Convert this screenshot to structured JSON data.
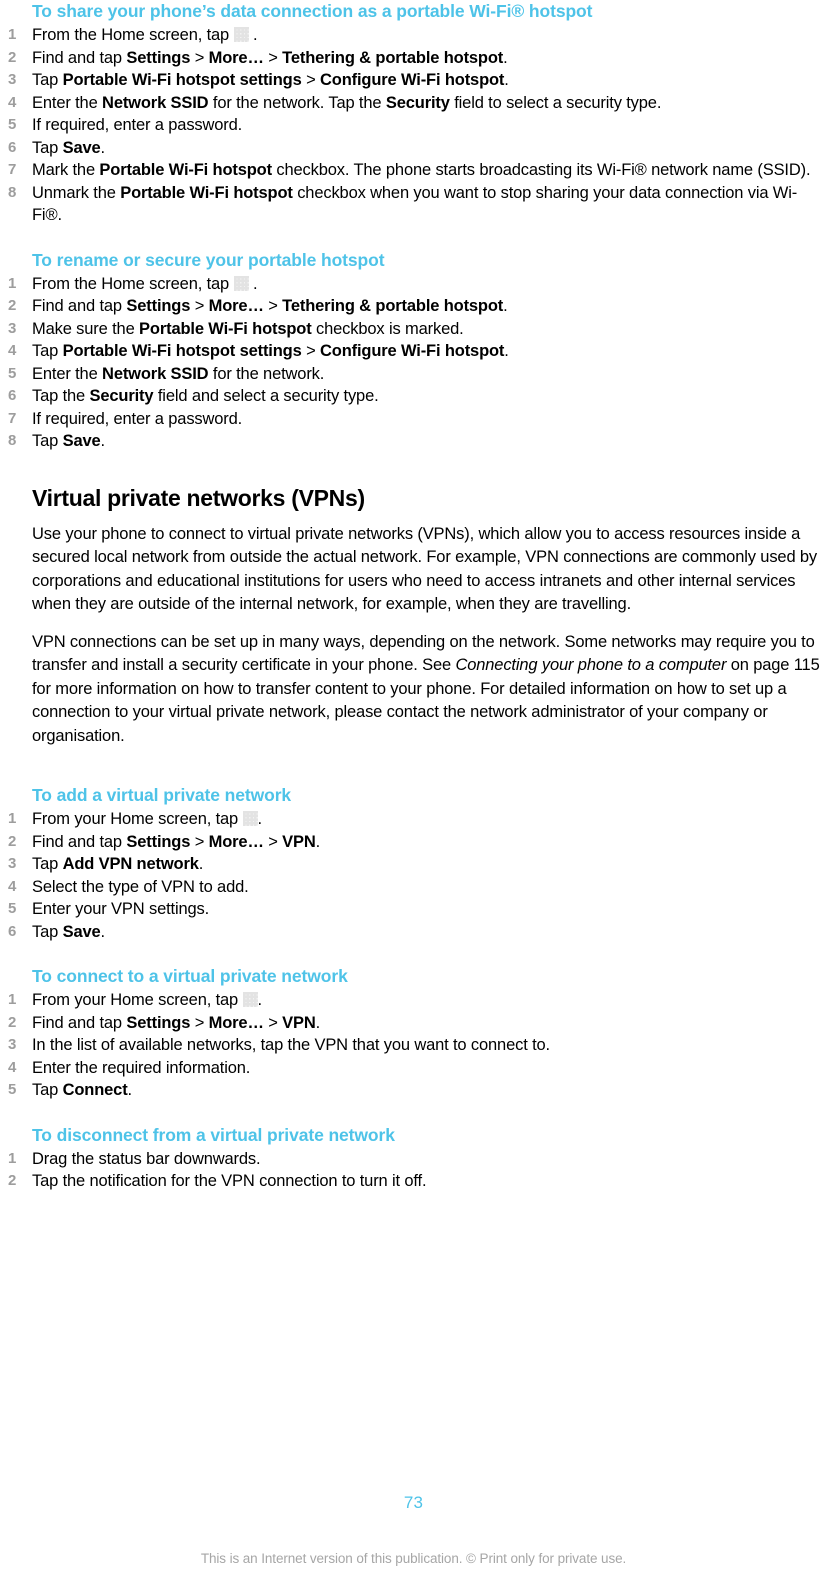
{
  "document": {
    "page_number": "73",
    "footer_note": "This is an Internet version of this publication. © Print only for private use.",
    "accent_color": "#4ec3e8",
    "step_number_color": "#9d9d9d",
    "icon_name": "app-drawer-grid-icon"
  },
  "sections": [
    {
      "id": "share-hotspot",
      "type": "task",
      "heading": "To share your phone’s data connection as a portable Wi-Fi® hotspot",
      "steps": [
        {
          "pre": "From the Home screen, tap ",
          "icon": true,
          "post": " ."
        },
        {
          "parts": [
            {
              "t": "Find and tap ",
              "b": false
            },
            {
              "t": "Settings",
              "b": true
            },
            {
              "t": " > ",
              "b": false
            },
            {
              "t": "More…",
              "b": true
            },
            {
              "t": " > ",
              "b": false
            },
            {
              "t": "Tethering & portable hotspot",
              "b": true
            },
            {
              "t": ".",
              "b": false
            }
          ]
        },
        {
          "parts": [
            {
              "t": "Tap ",
              "b": false
            },
            {
              "t": "Portable Wi-Fi hotspot settings",
              "b": true
            },
            {
              "t": " > ",
              "b": false
            },
            {
              "t": "Configure Wi-Fi hotspot",
              "b": true
            },
            {
              "t": ".",
              "b": false
            }
          ]
        },
        {
          "parts": [
            {
              "t": "Enter the ",
              "b": false
            },
            {
              "t": "Network SSID",
              "b": true
            },
            {
              "t": " for the network. Tap the ",
              "b": false
            },
            {
              "t": "Security",
              "b": true
            },
            {
              "t": " field to select a security type.",
              "b": false
            }
          ]
        },
        {
          "parts": [
            {
              "t": "If required, enter a password.",
              "b": false
            }
          ]
        },
        {
          "parts": [
            {
              "t": "Tap ",
              "b": false
            },
            {
              "t": "Save",
              "b": true
            },
            {
              "t": ".",
              "b": false
            }
          ]
        },
        {
          "parts": [
            {
              "t": "Mark the ",
              "b": false
            },
            {
              "t": "Portable Wi-Fi hotspot",
              "b": true
            },
            {
              "t": " checkbox. The phone starts broadcasting its Wi-Fi® network name (SSID).",
              "b": false
            }
          ]
        },
        {
          "parts": [
            {
              "t": "Unmark the ",
              "b": false
            },
            {
              "t": "Portable Wi-Fi hotspot",
              "b": true
            },
            {
              "t": " checkbox when you want to stop sharing your data connection via Wi-Fi®.",
              "b": false
            }
          ]
        }
      ]
    },
    {
      "id": "rename-secure-hotspot",
      "type": "task",
      "heading": "To rename or secure your portable hotspot",
      "steps": [
        {
          "pre": "From the Home screen, tap ",
          "icon": true,
          "post": " ."
        },
        {
          "parts": [
            {
              "t": "Find and tap ",
              "b": false
            },
            {
              "t": "Settings",
              "b": true
            },
            {
              "t": " > ",
              "b": false
            },
            {
              "t": "More…",
              "b": true
            },
            {
              "t": " > ",
              "b": false
            },
            {
              "t": "Tethering & portable hotspot",
              "b": true
            },
            {
              "t": ".",
              "b": false
            }
          ]
        },
        {
          "parts": [
            {
              "t": "Make sure the ",
              "b": false
            },
            {
              "t": "Portable Wi-Fi hotspot",
              "b": true
            },
            {
              "t": " checkbox is marked.",
              "b": false
            }
          ]
        },
        {
          "parts": [
            {
              "t": "Tap ",
              "b": false
            },
            {
              "t": "Portable Wi-Fi hotspot settings",
              "b": true
            },
            {
              "t": " > ",
              "b": false
            },
            {
              "t": "Configure Wi-Fi hotspot",
              "b": true
            },
            {
              "t": ".",
              "b": false
            }
          ]
        },
        {
          "parts": [
            {
              "t": "Enter the ",
              "b": false
            },
            {
              "t": "Network SSID",
              "b": true
            },
            {
              "t": " for the network.",
              "b": false
            }
          ]
        },
        {
          "parts": [
            {
              "t": "Tap the ",
              "b": false
            },
            {
              "t": "Security",
              "b": true
            },
            {
              "t": " field and select a security type.",
              "b": false
            }
          ]
        },
        {
          "parts": [
            {
              "t": "If required, enter a password.",
              "b": false
            }
          ]
        },
        {
          "parts": [
            {
              "t": "Tap ",
              "b": false
            },
            {
              "t": "Save",
              "b": true
            },
            {
              "t": ".",
              "b": false
            }
          ]
        }
      ]
    },
    {
      "id": "vpn",
      "type": "section",
      "heading": "Virtual private networks (VPNs)",
      "paragraphs": [
        [
          {
            "t": "Use your phone to connect to virtual private networks (VPNs), which allow you to access resources inside a secured local network from outside the actual network. For example, VPN connections are commonly used by corporations and educational institutions for users who need to access intranets and other internal services when they are outside of the internal network, for example, when they are travelling.",
            "i": false
          }
        ],
        [
          {
            "t": "VPN connections can be set up in many ways, depending on the network. Some networks may require you to transfer and install a security certificate in your phone. See ",
            "i": false
          },
          {
            "t": "Connecting your phone to a computer",
            "i": true
          },
          {
            "t": " on page 115 for more information on how to transfer content to your phone. For detailed information on how to set up a connection to your virtual private network, please contact the network administrator of your company or organisation.",
            "i": false
          }
        ]
      ]
    },
    {
      "id": "add-vpn",
      "type": "task",
      "heading": "To add a virtual private network",
      "steps": [
        {
          "pre": "From your Home screen, tap ",
          "icon": true,
          "post": "."
        },
        {
          "parts": [
            {
              "t": "Find and tap ",
              "b": false
            },
            {
              "t": "Settings",
              "b": true
            },
            {
              "t": " > ",
              "b": false
            },
            {
              "t": "More…",
              "b": true
            },
            {
              "t": " > ",
              "b": false
            },
            {
              "t": "VPN",
              "b": true
            },
            {
              "t": ".",
              "b": false
            }
          ]
        },
        {
          "parts": [
            {
              "t": "Tap ",
              "b": false
            },
            {
              "t": "Add VPN network",
              "b": true
            },
            {
              "t": ".",
              "b": false
            }
          ]
        },
        {
          "parts": [
            {
              "t": "Select the type of VPN to add.",
              "b": false
            }
          ]
        },
        {
          "parts": [
            {
              "t": "Enter your VPN settings.",
              "b": false
            }
          ]
        },
        {
          "parts": [
            {
              "t": "Tap ",
              "b": false
            },
            {
              "t": "Save",
              "b": true
            },
            {
              "t": ".",
              "b": false
            }
          ]
        }
      ]
    },
    {
      "id": "connect-vpn",
      "type": "task",
      "heading": "To connect to a virtual private network",
      "steps": [
        {
          "pre": "From your Home screen, tap ",
          "icon": true,
          "post": "."
        },
        {
          "parts": [
            {
              "t": "Find and tap ",
              "b": false
            },
            {
              "t": "Settings",
              "b": true
            },
            {
              "t": " > ",
              "b": false
            },
            {
              "t": "More…",
              "b": true
            },
            {
              "t": " > ",
              "b": false
            },
            {
              "t": "VPN",
              "b": true
            },
            {
              "t": ".",
              "b": false
            }
          ]
        },
        {
          "parts": [
            {
              "t": "In the list of available networks, tap the VPN that you want to connect to.",
              "b": false
            }
          ]
        },
        {
          "parts": [
            {
              "t": "Enter the required information.",
              "b": false
            }
          ]
        },
        {
          "parts": [
            {
              "t": "Tap ",
              "b": false
            },
            {
              "t": "Connect",
              "b": true
            },
            {
              "t": ".",
              "b": false
            }
          ]
        }
      ]
    },
    {
      "id": "disconnect-vpn",
      "type": "task",
      "heading": "To disconnect from a virtual private network",
      "steps": [
        {
          "parts": [
            {
              "t": "Drag the status bar downwards.",
              "b": false
            }
          ]
        },
        {
          "parts": [
            {
              "t": "Tap the notification for the VPN connection to turn it off.",
              "b": false
            }
          ]
        }
      ]
    }
  ]
}
